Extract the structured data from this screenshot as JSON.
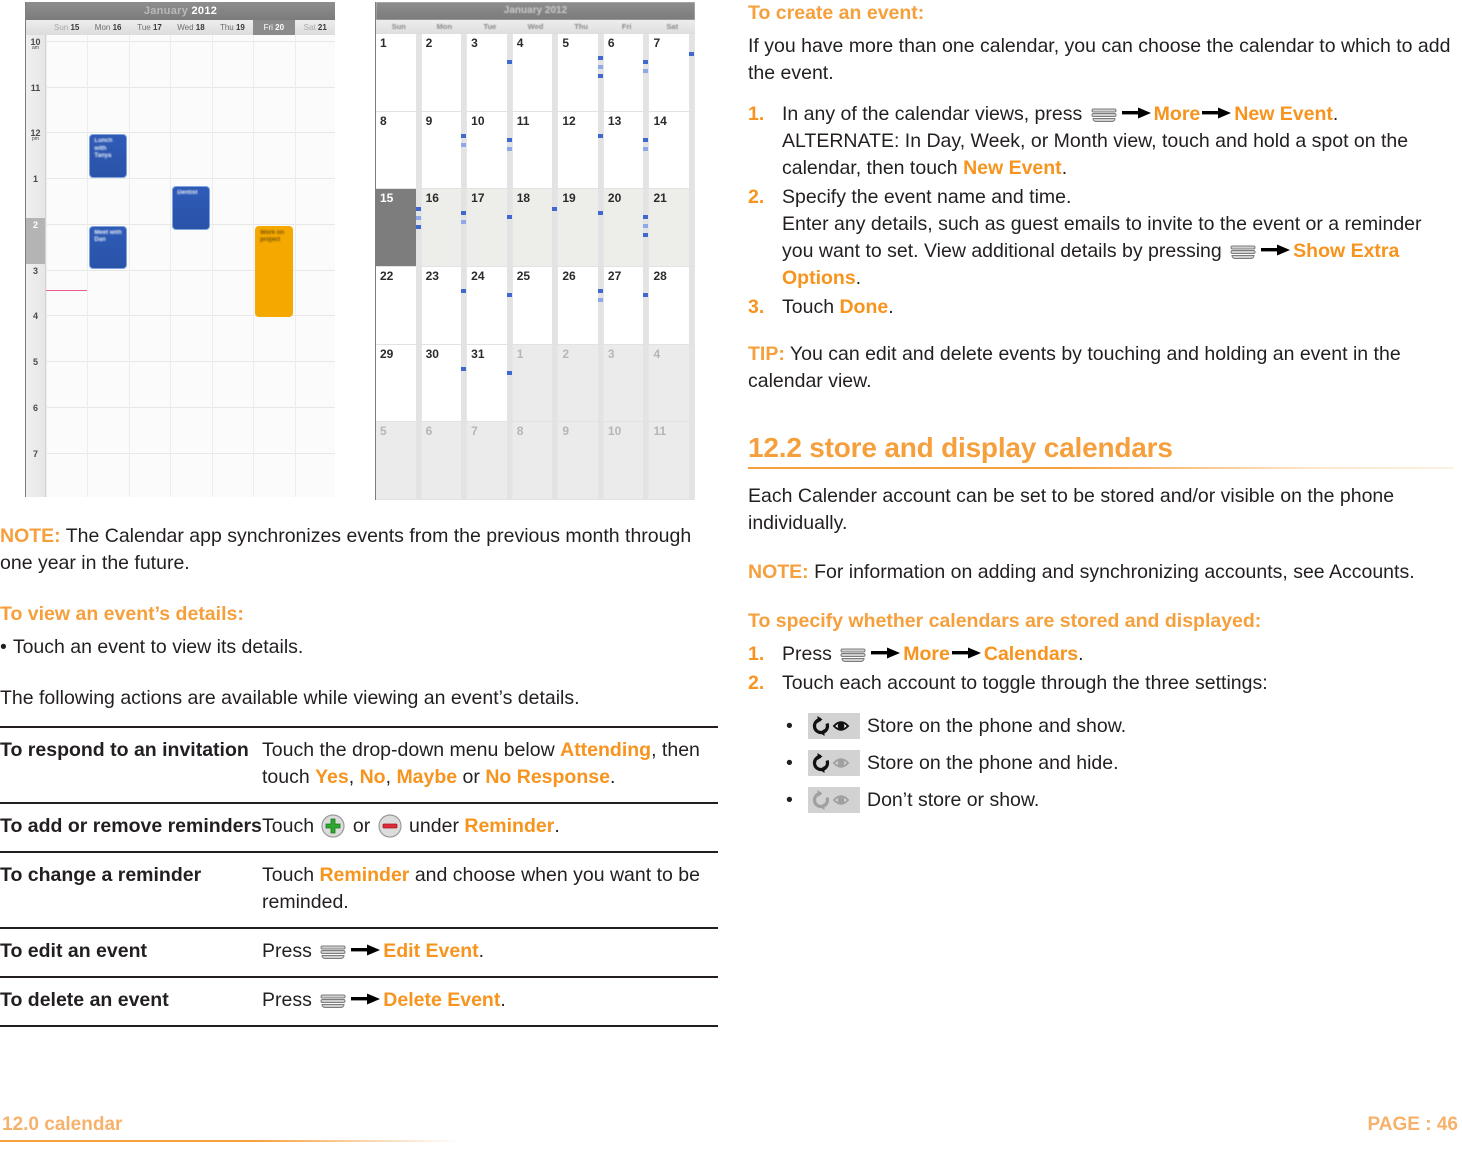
{
  "left": {
    "note": {
      "label": "NOTE:",
      "text": " The Calendar app synchronizes events from the previous month through one year in the future."
    },
    "heading_view_details": "To view an event’s details:",
    "bullet_touch_event": "Touch an event to view its details.",
    "para_following": "The following actions are available while viewing an event’s details.",
    "table": {
      "rows": [
        {
          "action": "To respond to an invitation",
          "parts": [
            {
              "t": "Touch the drop-down menu below "
            },
            {
              "t": "Attending",
              "s": "orange"
            },
            {
              "t": ", then touch "
            },
            {
              "t": "Yes",
              "s": "orange"
            },
            {
              "t": ", "
            },
            {
              "t": "No",
              "s": "orange"
            },
            {
              "t": ", "
            },
            {
              "t": "Maybe",
              "s": "orange"
            },
            {
              "t": " or "
            },
            {
              "t": "No Response",
              "s": "orange"
            },
            {
              "t": "."
            }
          ]
        },
        {
          "action": "To add or remove reminders",
          "parts": [
            {
              "t": "Touch "
            },
            {
              "t": "",
              "s": "icon-plus"
            },
            {
              "t": " or "
            },
            {
              "t": "",
              "s": "icon-minus"
            },
            {
              "t": " under "
            },
            {
              "t": "Reminder",
              "s": "orange"
            },
            {
              "t": "."
            }
          ]
        },
        {
          "action": "To change a reminder",
          "parts": [
            {
              "t": "Touch "
            },
            {
              "t": "Reminder",
              "s": "orange"
            },
            {
              "t": " and choose when you want to be reminded."
            }
          ]
        },
        {
          "action": "To edit an event",
          "parts": [
            {
              "t": "Press "
            },
            {
              "t": "",
              "s": "icon-menu"
            },
            {
              "t": "",
              "s": "icon-arrow"
            },
            {
              "t": "Edit Event",
              "s": "orange"
            },
            {
              "t": "."
            }
          ]
        },
        {
          "action": "To delete an event",
          "parts": [
            {
              "t": "Press "
            },
            {
              "t": "",
              "s": "icon-menu"
            },
            {
              "t": "",
              "s": "icon-arrow"
            },
            {
              "t": "Delete Event",
              "s": "orange"
            },
            {
              "t": "."
            }
          ]
        }
      ]
    }
  },
  "right": {
    "heading_create_event": "To create an event:",
    "para_more_than_one": "If you have more than one calendar, you can choose the calendar to which to add the event.",
    "steps_create": [
      {
        "num": "1.",
        "parts": [
          {
            "t": "In any of the calendar views, press "
          },
          {
            "t": "",
            "s": "icon-menu"
          },
          {
            "t": "",
            "s": "icon-arrow"
          },
          {
            "t": "More",
            "s": "orange"
          },
          {
            "t": "",
            "s": "icon-arrow"
          },
          {
            "t": "New Event",
            "s": "orange"
          },
          {
            "t": "."
          }
        ],
        "sub": [
          {
            "t": "ALTERNATE: In Day, Week, or Month view, touch and hold a spot on the calendar, then touch "
          },
          {
            "t": "New Event",
            "s": "orange"
          },
          {
            "t": "."
          }
        ]
      },
      {
        "num": "2.",
        "parts": [
          {
            "t": "Specify the event name and time."
          }
        ],
        "sub": [
          {
            "t": "Enter any details, such as guest emails to invite to the event or a reminder you want to set. View additional details by pressing "
          },
          {
            "t": "",
            "s": "icon-menu"
          },
          {
            "t": "",
            "s": "icon-arrow"
          },
          {
            "t": "Show Extra Options",
            "s": "orange"
          },
          {
            "t": "."
          }
        ]
      },
      {
        "num": "3.",
        "parts": [
          {
            "t": "Touch "
          },
          {
            "t": "Done",
            "s": "orange"
          },
          {
            "t": "."
          }
        ]
      }
    ],
    "tip": {
      "label": "TIP:",
      "text": " You can edit and delete events by touching and holding an event in the calendar view."
    },
    "section_title": "12.2 store and display calendars",
    "para_each_account": "Each Calender account can be set to be stored and/or visible on the phone individually.",
    "note2": {
      "label": "NOTE:",
      "text": " For information on adding and synchronizing accounts, see Accounts."
    },
    "heading_specify": "To specify whether calendars are stored and displayed:",
    "steps_specify": [
      {
        "num": "1.",
        "parts": [
          {
            "t": "Press "
          },
          {
            "t": "",
            "s": "icon-menu"
          },
          {
            "t": "",
            "s": "icon-arrow"
          },
          {
            "t": "More",
            "s": "orange"
          },
          {
            "t": "",
            "s": "icon-arrow"
          },
          {
            "t": "Calendars",
            "s": "orange"
          },
          {
            "t": "."
          }
        ]
      },
      {
        "num": "2.",
        "parts": [
          {
            "t": "Touch each account to toggle through the three settings:"
          }
        ]
      }
    ],
    "settings_bullets": [
      {
        "icon": "sync-eye-on",
        "text": "Store on the phone and show."
      },
      {
        "icon": "sync-eye-off",
        "text": "Store on the phone and hide."
      },
      {
        "icon": "sync-off-eye-off",
        "text": "Don’t store or show."
      }
    ]
  },
  "footer": {
    "left": "12.0 calendar",
    "right": "PAGE : 46"
  },
  "week_view": {
    "title_month": "January",
    "title_year": "2012",
    "days": [
      {
        "name": "Sun",
        "num": "15",
        "weekend": true
      },
      {
        "name": "Mon",
        "num": "16"
      },
      {
        "name": "Tue",
        "num": "17"
      },
      {
        "name": "Wed",
        "num": "18"
      },
      {
        "name": "Thu",
        "num": "19"
      },
      {
        "name": "Fri",
        "num": "20",
        "selected": true
      },
      {
        "name": "Sat",
        "num": "21",
        "weekend": true
      }
    ],
    "hours": [
      "10",
      "11",
      "12",
      "1",
      "2",
      "3",
      "4",
      "5",
      "6",
      "7"
    ],
    "hour_ampm": {
      "10": "am",
      "12": "pm"
    },
    "highlight_hour": "2",
    "events": [
      {
        "title": "Lunch with Tanya",
        "day": 1,
        "color": "blue"
      },
      {
        "title": "Dentist",
        "day": 3,
        "color": "blue"
      },
      {
        "title": "Meet with Dan",
        "day": 1,
        "color": "blue"
      },
      {
        "title": "Work on project",
        "day": 5,
        "color": "orange"
      }
    ]
  },
  "month_view": {
    "title": "January 2012",
    "day_headers": [
      "Sun",
      "Mon",
      "Tue",
      "Wed",
      "Thu",
      "Fri",
      "Sat"
    ],
    "today": "15",
    "weeks": [
      [
        {
          "n": "1"
        },
        {
          "n": "2"
        },
        {
          "n": "3",
          "dots": 1
        },
        {
          "n": "4"
        },
        {
          "n": "5",
          "dots": 3
        },
        {
          "n": "6",
          "dots": 2
        },
        {
          "n": "7",
          "dots": 1
        }
      ],
      [
        {
          "n": "8"
        },
        {
          "n": "9",
          "dots": 2
        },
        {
          "n": "10",
          "dots": 2
        },
        {
          "n": "11"
        },
        {
          "n": "12",
          "dots": 1
        },
        {
          "n": "13",
          "dots": 2
        },
        {
          "n": "14"
        }
      ],
      [
        {
          "n": "15",
          "today": true,
          "dots": 3
        },
        {
          "n": "16",
          "dots": 2
        },
        {
          "n": "17",
          "dots": 1
        },
        {
          "n": "18",
          "dots": 1
        },
        {
          "n": "19",
          "dots": 1
        },
        {
          "n": "20",
          "dots": 3
        },
        {
          "n": "21"
        }
      ],
      [
        {
          "n": "22"
        },
        {
          "n": "23",
          "dots": 1
        },
        {
          "n": "24",
          "dots": 1
        },
        {
          "n": "25"
        },
        {
          "n": "26",
          "dots": 2
        },
        {
          "n": "27",
          "dots": 1
        },
        {
          "n": "28"
        }
      ],
      [
        {
          "n": "29"
        },
        {
          "n": "30",
          "dots": 1
        },
        {
          "n": "31",
          "dots": 1
        },
        {
          "n": "1",
          "out": true
        },
        {
          "n": "2",
          "out": true
        },
        {
          "n": "3",
          "out": true
        },
        {
          "n": "4",
          "out": true
        }
      ],
      [
        {
          "n": "5",
          "out": true
        },
        {
          "n": "6",
          "out": true
        },
        {
          "n": "7",
          "out": true
        },
        {
          "n": "8",
          "out": true
        },
        {
          "n": "9",
          "out": true
        },
        {
          "n": "10",
          "out": true
        },
        {
          "n": "11",
          "out": true
        }
      ]
    ]
  }
}
